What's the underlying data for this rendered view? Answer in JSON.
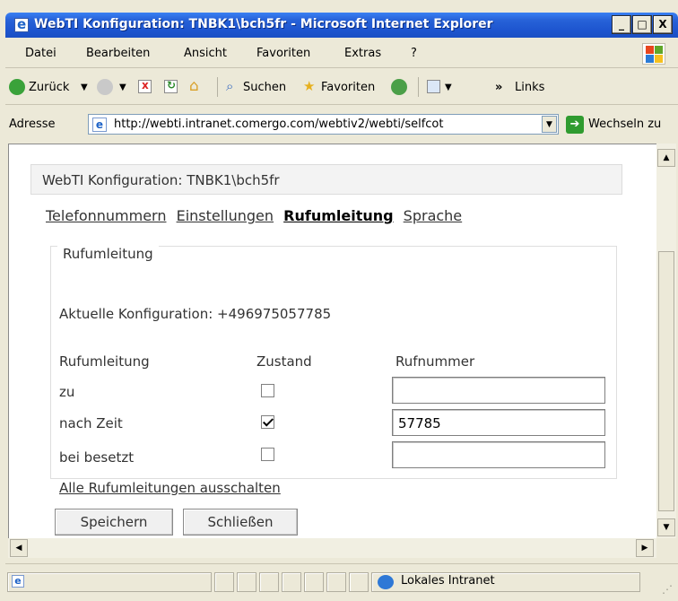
{
  "window": {
    "title": "WebTI Konfiguration: TNBK1\\bch5fr - Microsoft Internet Explorer",
    "minimize_label": "_",
    "maximize_label": "□",
    "close_label": "X"
  },
  "menu": [
    "Datei",
    "Bearbeiten",
    "Ansicht",
    "Favoriten",
    "Extras",
    "?"
  ],
  "toolbar": {
    "back_label": "Zurück",
    "search_label": "Suchen",
    "favorites_label": "Favoriten",
    "overflow_label": "»",
    "links_label": "Links"
  },
  "address": {
    "label": "Adresse",
    "url": "http://webti.intranet.comergo.com/webtiv2/webti/selfcot",
    "go_label": "Wechseln zu"
  },
  "page": {
    "panel_title": "WebTI Konfiguration: TNBK1\\bch5fr",
    "nav": [
      "Telefonnummern",
      "Einstellungen",
      "Rufumleitung",
      "Sprache"
    ],
    "active_nav": "Rufumleitung",
    "section_legend": "Rufumleitung",
    "current_config_label": "Aktuelle Konfiguration: +496975057785",
    "table_headers": {
      "col1": "Rufumleitung",
      "col2": "Zustand",
      "col3": "Rufnummer"
    },
    "rows": [
      {
        "label": "zu",
        "checked": false,
        "number": ""
      },
      {
        "label": "nach Zeit",
        "checked": true,
        "number": "57785"
      },
      {
        "label": "bei besetzt",
        "checked": false,
        "number": ""
      }
    ],
    "disable_all_link": "Alle Rufumleitungen ausschalten",
    "save_button": "Speichern",
    "close_button": "Schließen"
  },
  "status": {
    "zone_label": "Lokales Intranet"
  }
}
